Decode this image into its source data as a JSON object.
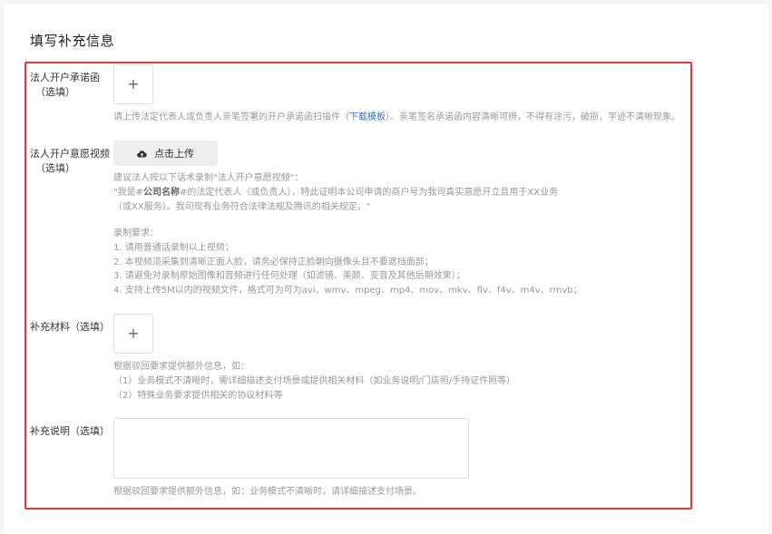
{
  "page": {
    "title": "填写补充信息"
  },
  "fields": {
    "commitment_letter": {
      "label": "法人开户承诺函",
      "optional": "（选填）",
      "plus": "+",
      "hint_prefix": "请上传法定代表人或负责人亲笔签署的开户承诺函扫描件（",
      "hint_link": "下载模板",
      "hint_suffix": "）。亲笔签名承诺函内容清晰可辨，不得有涂污，破损，字迹不清晰现象。"
    },
    "video": {
      "label": "法人开户意愿视频",
      "optional": "（选填）",
      "upload_label": "点击上传",
      "hint_line1": "建议法人按以下话术录制\"法人开户意愿视频\"：",
      "hint_line2_prefix": "\"我是#",
      "hint_line2_bold": "公司名称",
      "hint_line2_suffix": "#的法定代表人（或负责人），特此证明本公司申请的商户号为我司真实意愿开立且用于XX业务",
      "hint_line3": "（或XX服务）。我司现有业务符合法律法规及腾讯的相关规定。\"",
      "requirements_title": "录制要求：",
      "requirements": [
        "1. 请用普通话录制以上视频；",
        "2. 本视频须采集到清晰正面人脸，请务必保持正脸朝向摄像头且不要遮挡面部；",
        "3. 请避免对录制原始图像和音频进行任何处理（如滤镜、美颜、变音及其他后期效果）；",
        "4. 支持上传5M以内的视频文件，格式可为可为avi、wmv、mpeg、mp4、mov、mkv、flv、f4v、m4v、rmvb；"
      ]
    },
    "materials": {
      "label": "补充材料（选填）",
      "plus": "+",
      "hint_lines": [
        "根据驳回要求提供额外信息，如：",
        "（1）业务模式不清晰时，需详细描述支付场景或提供相关材料（如业务说明/门店照/手持证件照等）",
        "（2）特殊业务要求提供相关的协议材料等"
      ]
    },
    "description": {
      "label": "补充说明（选填）",
      "value": "",
      "hint": "根据驳回要求提供额外信息，如：业务模式不清晰时，请详细描述支付场景。"
    }
  },
  "colors": {
    "highlight_border": "#e43a3a",
    "link": "#2f6fd8",
    "hint_text": "#999999"
  },
  "icons": {
    "upload": "cloud-upload-icon",
    "add": "plus-icon"
  }
}
